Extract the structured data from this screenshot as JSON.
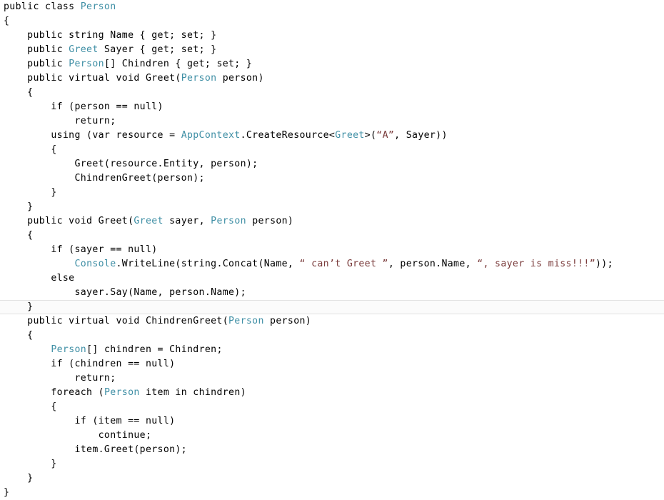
{
  "editor": {
    "language": "csharp",
    "background_color": "#ffffff",
    "default_text_color": "#000000",
    "type_token_color": "#3f8fa5",
    "string_token_color": "#7a3b3b",
    "current_line_border_color": "#e2e2e2",
    "current_line_index": 21
  },
  "code": {
    "lines": [
      {
        "n": 1,
        "indent": 0,
        "current": false,
        "segments": [
          {
            "t": "public class ",
            "k": "plain"
          },
          {
            "t": "Person",
            "k": "type"
          }
        ]
      },
      {
        "n": 2,
        "indent": 0,
        "current": false,
        "segments": [
          {
            "t": "{",
            "k": "plain"
          }
        ]
      },
      {
        "n": 3,
        "indent": 0,
        "current": false,
        "segments": [
          {
            "t": "    public string Name { get; set; }",
            "k": "plain"
          }
        ]
      },
      {
        "n": 4,
        "indent": 0,
        "current": false,
        "segments": [
          {
            "t": "    public ",
            "k": "plain"
          },
          {
            "t": "Greet",
            "k": "type"
          },
          {
            "t": " Sayer { get; set; }",
            "k": "plain"
          }
        ]
      },
      {
        "n": 5,
        "indent": 0,
        "current": false,
        "segments": [
          {
            "t": "    public ",
            "k": "plain"
          },
          {
            "t": "Person",
            "k": "type"
          },
          {
            "t": "[] Chindren { get; set; }",
            "k": "plain"
          }
        ]
      },
      {
        "n": 6,
        "indent": 0,
        "current": false,
        "segments": [
          {
            "t": "    public virtual void Greet(",
            "k": "plain"
          },
          {
            "t": "Person",
            "k": "type"
          },
          {
            "t": " person)",
            "k": "plain"
          }
        ]
      },
      {
        "n": 7,
        "indent": 0,
        "current": false,
        "segments": [
          {
            "t": "    {",
            "k": "plain"
          }
        ]
      },
      {
        "n": 8,
        "indent": 0,
        "current": false,
        "segments": [
          {
            "t": "        if (person == null)",
            "k": "plain"
          }
        ]
      },
      {
        "n": 9,
        "indent": 0,
        "current": false,
        "segments": [
          {
            "t": "            return;",
            "k": "plain"
          }
        ]
      },
      {
        "n": 10,
        "indent": 0,
        "current": false,
        "segments": [
          {
            "t": "        using (var resource = ",
            "k": "plain"
          },
          {
            "t": "AppContext",
            "k": "type"
          },
          {
            "t": ".CreateResource<",
            "k": "plain"
          },
          {
            "t": "Greet",
            "k": "type"
          },
          {
            "t": ">(",
            "k": "plain"
          },
          {
            "t": "“A”",
            "k": "string"
          },
          {
            "t": ", Sayer))",
            "k": "plain"
          }
        ]
      },
      {
        "n": 11,
        "indent": 0,
        "current": false,
        "segments": [
          {
            "t": "        {",
            "k": "plain"
          }
        ]
      },
      {
        "n": 12,
        "indent": 0,
        "current": false,
        "segments": [
          {
            "t": "            Greet(resource.Entity, person);",
            "k": "plain"
          }
        ]
      },
      {
        "n": 13,
        "indent": 0,
        "current": false,
        "segments": [
          {
            "t": "            ChindrenGreet(person);",
            "k": "plain"
          }
        ]
      },
      {
        "n": 14,
        "indent": 0,
        "current": false,
        "segments": [
          {
            "t": "        }",
            "k": "plain"
          }
        ]
      },
      {
        "n": 15,
        "indent": 0,
        "current": false,
        "segments": [
          {
            "t": "    }",
            "k": "plain"
          }
        ]
      },
      {
        "n": 16,
        "indent": 0,
        "current": false,
        "segments": [
          {
            "t": "    public void Greet(",
            "k": "plain"
          },
          {
            "t": "Greet",
            "k": "type"
          },
          {
            "t": " sayer, ",
            "k": "plain"
          },
          {
            "t": "Person",
            "k": "type"
          },
          {
            "t": " person)",
            "k": "plain"
          }
        ]
      },
      {
        "n": 17,
        "indent": 0,
        "current": false,
        "segments": [
          {
            "t": "    {",
            "k": "plain"
          }
        ]
      },
      {
        "n": 18,
        "indent": 0,
        "current": false,
        "segments": [
          {
            "t": "        if (sayer == null)",
            "k": "plain"
          }
        ]
      },
      {
        "n": 19,
        "indent": 0,
        "current": false,
        "segments": [
          {
            "t": "            ",
            "k": "plain"
          },
          {
            "t": "Console",
            "k": "type"
          },
          {
            "t": ".WriteLine(string.Concat(Name, ",
            "k": "plain"
          },
          {
            "t": "“ can’t Greet ”",
            "k": "string"
          },
          {
            "t": ", person.Name, ",
            "k": "plain"
          },
          {
            "t": "“, sayer is miss!!!”",
            "k": "string"
          },
          {
            "t": "));",
            "k": "plain"
          }
        ]
      },
      {
        "n": 20,
        "indent": 0,
        "current": false,
        "segments": [
          {
            "t": "        else",
            "k": "plain"
          }
        ]
      },
      {
        "n": 21,
        "indent": 0,
        "current": false,
        "segments": [
          {
            "t": "            sayer.Say(Name, person.Name);",
            "k": "plain"
          }
        ]
      },
      {
        "n": 22,
        "indent": 0,
        "current": true,
        "segments": [
          {
            "t": "    }",
            "k": "plain"
          }
        ]
      },
      {
        "n": 23,
        "indent": 0,
        "current": false,
        "segments": [
          {
            "t": "    public virtual void ChindrenGreet(",
            "k": "plain"
          },
          {
            "t": "Person",
            "k": "type"
          },
          {
            "t": " person)",
            "k": "plain"
          }
        ]
      },
      {
        "n": 24,
        "indent": 0,
        "current": false,
        "segments": [
          {
            "t": "    {",
            "k": "plain"
          }
        ]
      },
      {
        "n": 25,
        "indent": 0,
        "current": false,
        "segments": [
          {
            "t": "        ",
            "k": "plain"
          },
          {
            "t": "Person",
            "k": "type"
          },
          {
            "t": "[] chindren = Chindren;",
            "k": "plain"
          }
        ]
      },
      {
        "n": 26,
        "indent": 0,
        "current": false,
        "segments": [
          {
            "t": "        if (chindren == null)",
            "k": "plain"
          }
        ]
      },
      {
        "n": 27,
        "indent": 0,
        "current": false,
        "segments": [
          {
            "t": "            return;",
            "k": "plain"
          }
        ]
      },
      {
        "n": 28,
        "indent": 0,
        "current": false,
        "segments": [
          {
            "t": "        foreach (",
            "k": "plain"
          },
          {
            "t": "Person",
            "k": "type"
          },
          {
            "t": " item in chindren)",
            "k": "plain"
          }
        ]
      },
      {
        "n": 29,
        "indent": 0,
        "current": false,
        "segments": [
          {
            "t": "        {",
            "k": "plain"
          }
        ]
      },
      {
        "n": 30,
        "indent": 0,
        "current": false,
        "segments": [
          {
            "t": "            if (item == null)",
            "k": "plain"
          }
        ]
      },
      {
        "n": 31,
        "indent": 0,
        "current": false,
        "segments": [
          {
            "t": "                continue;",
            "k": "plain"
          }
        ]
      },
      {
        "n": 32,
        "indent": 0,
        "current": false,
        "segments": [
          {
            "t": "            item.Greet(person);",
            "k": "plain"
          }
        ]
      },
      {
        "n": 33,
        "indent": 0,
        "current": false,
        "segments": [
          {
            "t": "        }",
            "k": "plain"
          }
        ]
      },
      {
        "n": 34,
        "indent": 0,
        "current": false,
        "segments": [
          {
            "t": "    }",
            "k": "plain"
          }
        ]
      },
      {
        "n": 35,
        "indent": 0,
        "current": false,
        "segments": [
          {
            "t": "}",
            "k": "plain"
          }
        ]
      }
    ]
  }
}
